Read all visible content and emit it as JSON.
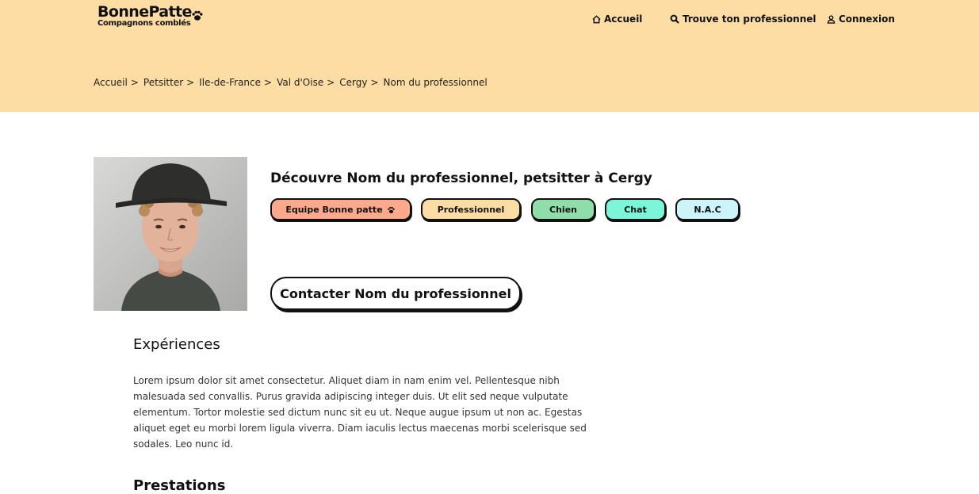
{
  "brand": {
    "name": "BonnePatte",
    "tagline": "Compagnons comblés"
  },
  "nav": {
    "home": "Accueil",
    "search": "Trouve ton professionnel",
    "login": "Connexion"
  },
  "breadcrumb": [
    "Accueil",
    "Petsitter",
    "Ile-de-France",
    "Val d'Oise",
    "Cergy",
    "Nom du professionnel"
  ],
  "breadcrumb_separator": ">",
  "profile": {
    "title": "Découvre Nom du professionnel, petsitter à Cergy",
    "tags": {
      "team": "Equipe Bonne patte",
      "pro": "Professionnel",
      "dog": "Chien",
      "cat": "Chat",
      "nac": "N.A.C"
    },
    "contact_label": "Contacter Nom du professionnel"
  },
  "experiences": {
    "title": "Expériences",
    "text": "Lorem ipsum dolor sit amet consectetur. Aliquet diam in nam enim vel. Pellentesque nibh malesuada sed convallis. Purus gravida adipiscing integer duis. Ut elit sed neque vulputate elementum. Tortor molestie sed dictum nunc sit eu ut. Neque augue ipsum ut non ac. Egestas aliquet eget eu morbi lorem ligula viverra. Diam iaculis lectus maecenas morbi scelerisque sed sodales. Leo nunc id."
  },
  "prestations": {
    "title": "Prestations"
  },
  "colors": {
    "header_bg": "#fddda4",
    "tag_team": "#fea88c",
    "tag_pro": "#fddda4",
    "tag_dog": "#8fdeaa",
    "tag_cat": "#7cf6d9",
    "tag_nac": "#ccf5fb"
  },
  "icons": {
    "logo": "paw-icon",
    "home": "home-icon",
    "search": "search-icon",
    "login": "user-icon",
    "team_tag": "paw-icon"
  }
}
